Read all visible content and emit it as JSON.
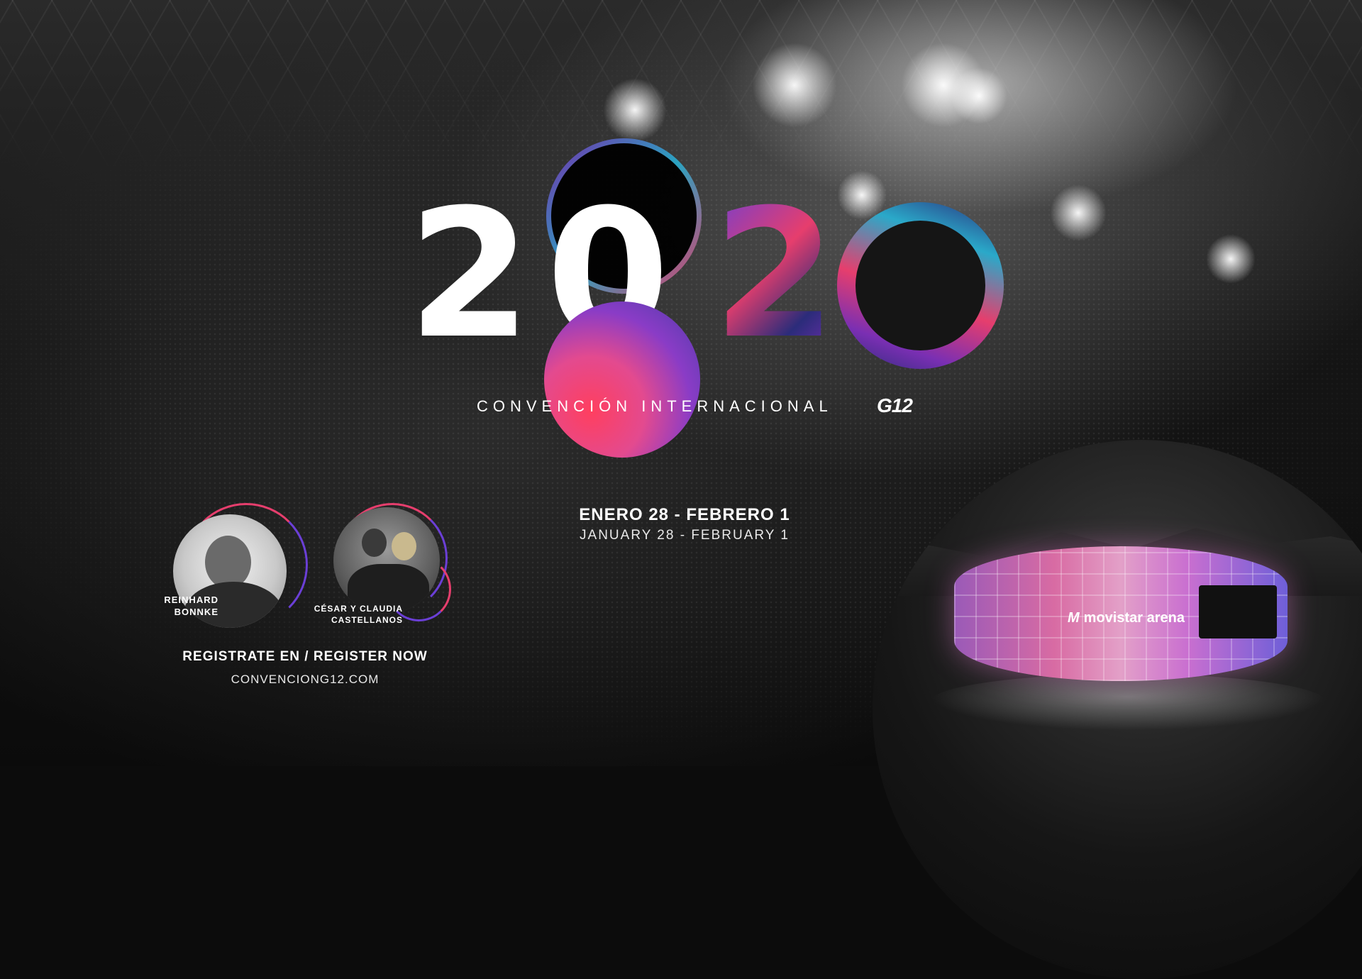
{
  "logo": {
    "year_digits": [
      "2",
      "0",
      "2",
      "0"
    ],
    "tagline": "CONVENCIÓN INTERNACIONAL",
    "brand_mark": "G12",
    "colors": {
      "pink": "#e63e6d",
      "purple": "#6b3fd6",
      "navy": "#2b2c7a",
      "teal": "#2aa9c9"
    }
  },
  "dates": {
    "spanish": "ENERO 28 - FEBRERO 1",
    "english": "JANUARY 28 - FEBRUARY 1"
  },
  "speakers": [
    {
      "name_line1": "REINHARD",
      "name_line2": "BONNKE"
    },
    {
      "name_line1": "CÉSAR Y CLAUDIA",
      "name_line2": "CASTELLANOS"
    }
  ],
  "register": {
    "label": "REGISTRATE EN / REGISTER NOW",
    "website": "CONVENCIONG12.COM"
  },
  "venue": {
    "name": "movistar arena",
    "logo_mark": "M"
  }
}
